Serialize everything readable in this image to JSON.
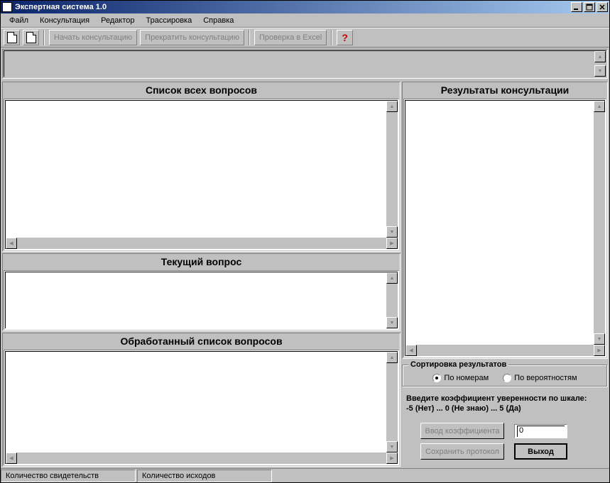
{
  "title": "Экспертная система 1.0",
  "menu": {
    "file": "Файл",
    "consult": "Консультация",
    "editor": "Редактор",
    "trace": "Трассировка",
    "help": "Справка"
  },
  "toolbar": {
    "start": "Начать консультацию",
    "stop": "Прекратить консультацию",
    "excel": "Проверка в Excel"
  },
  "panels": {
    "all_q": "Список всех вопросов",
    "cur_q": "Текущий вопрос",
    "proc_q": "Обработанный список вопросов",
    "results": "Результаты консультации"
  },
  "sort": {
    "legend": "Сортировка результатов",
    "by_num": "По номерам",
    "by_prob": "По вероятностям"
  },
  "input": {
    "line1": "Введите коэффициент уверенности по шкале:",
    "line2": "-5 (Нет) ... 0 (Не знаю) ... 5 (Да)",
    "value": "0"
  },
  "buttons": {
    "enter_coef": "Ввод коэффициента",
    "save_proto": "Сохранить протокол",
    "exit": "Выход"
  },
  "status": {
    "evidence": "Количество свидетельств",
    "outcomes": "Количество исходов"
  }
}
